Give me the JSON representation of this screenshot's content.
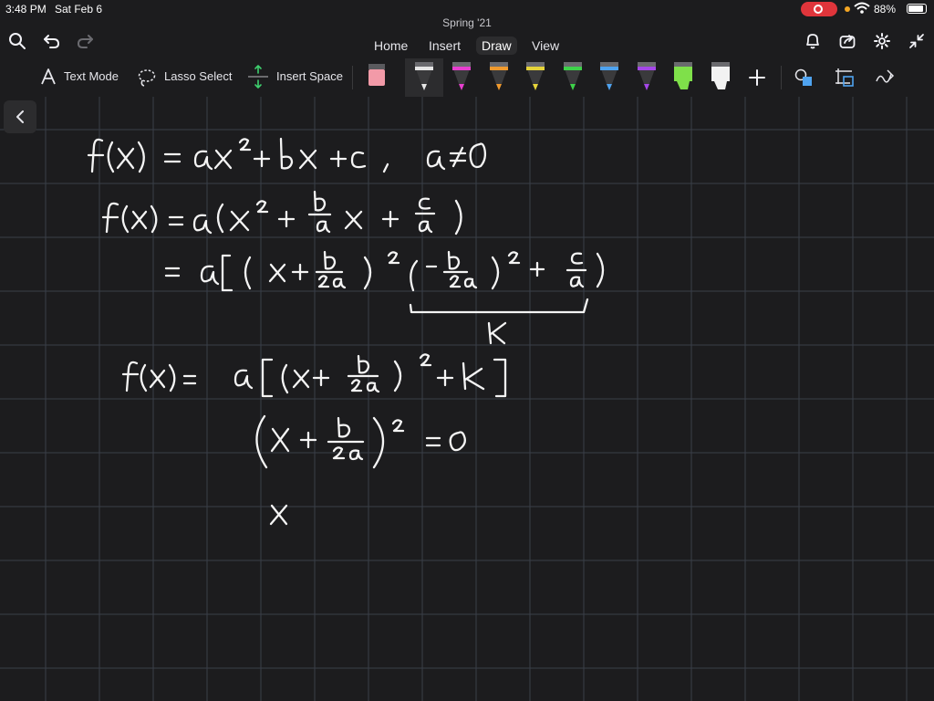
{
  "status": {
    "time": "3:48 PM",
    "date": "Sat Feb 6",
    "battery": "88%"
  },
  "document": {
    "title": "Spring '21"
  },
  "menu": {
    "home": "Home",
    "insert": "Insert",
    "draw": "Draw",
    "view": "View",
    "active": "Draw"
  },
  "tools": {
    "text_mode": "Text Mode",
    "lasso_select": "Lasso Select",
    "insert_space": "Insert Space"
  },
  "pens": [
    {
      "name": "pink-highlighter",
      "color": "#f29aa8"
    },
    {
      "name": "white-pen",
      "color": "#e6e6e6"
    },
    {
      "name": "magenta-pen",
      "color": "#e83fd0"
    },
    {
      "name": "orange-pen",
      "color": "#f09a2e"
    },
    {
      "name": "yellow-pen",
      "color": "#e6d43a"
    },
    {
      "name": "green-pen",
      "color": "#3ed24a"
    },
    {
      "name": "blue-pen",
      "color": "#4fa3f0"
    },
    {
      "name": "purple-pen",
      "color": "#a547e8"
    },
    {
      "name": "green-highlighter",
      "color": "#7fe04a"
    },
    {
      "name": "white-highlighter",
      "color": "#f2f2f2"
    }
  ],
  "colors": {
    "background": "#1c1c1e",
    "grid": "#3a3f48",
    "ink": "#f4f4f4",
    "accent": "#ffffff"
  }
}
